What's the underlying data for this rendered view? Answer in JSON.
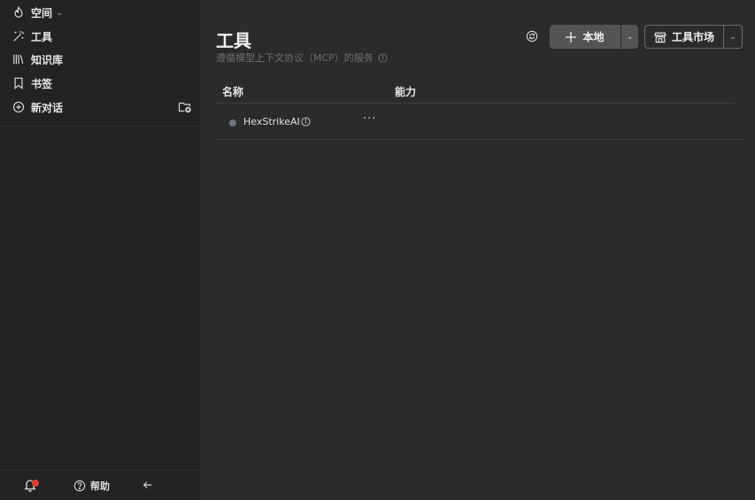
{
  "sidebar": {
    "space_label": "空间",
    "items": [
      {
        "label": "工具",
        "icon": "magic-wand-icon"
      },
      {
        "label": "知识库",
        "icon": "books-icon"
      },
      {
        "label": "书签",
        "icon": "bookmark-icon"
      },
      {
        "label": "新对话",
        "icon": "plus-circle-icon"
      }
    ],
    "help_label": "帮助"
  },
  "main": {
    "title": "工具",
    "subtitle": "遵循模型上下文协议（MCP）的服务",
    "local_button": "本地",
    "market_button": "工具市场",
    "columns": {
      "name": "名称",
      "capability": "能力"
    },
    "rows": [
      {
        "name": "HexStrikeAI",
        "more": "···"
      }
    ]
  },
  "colors": {
    "sidebar_bg": "#232323",
    "main_bg": "#2b2b2b",
    "notification_dot": "#e53935",
    "status_dot": "#6c7480"
  }
}
